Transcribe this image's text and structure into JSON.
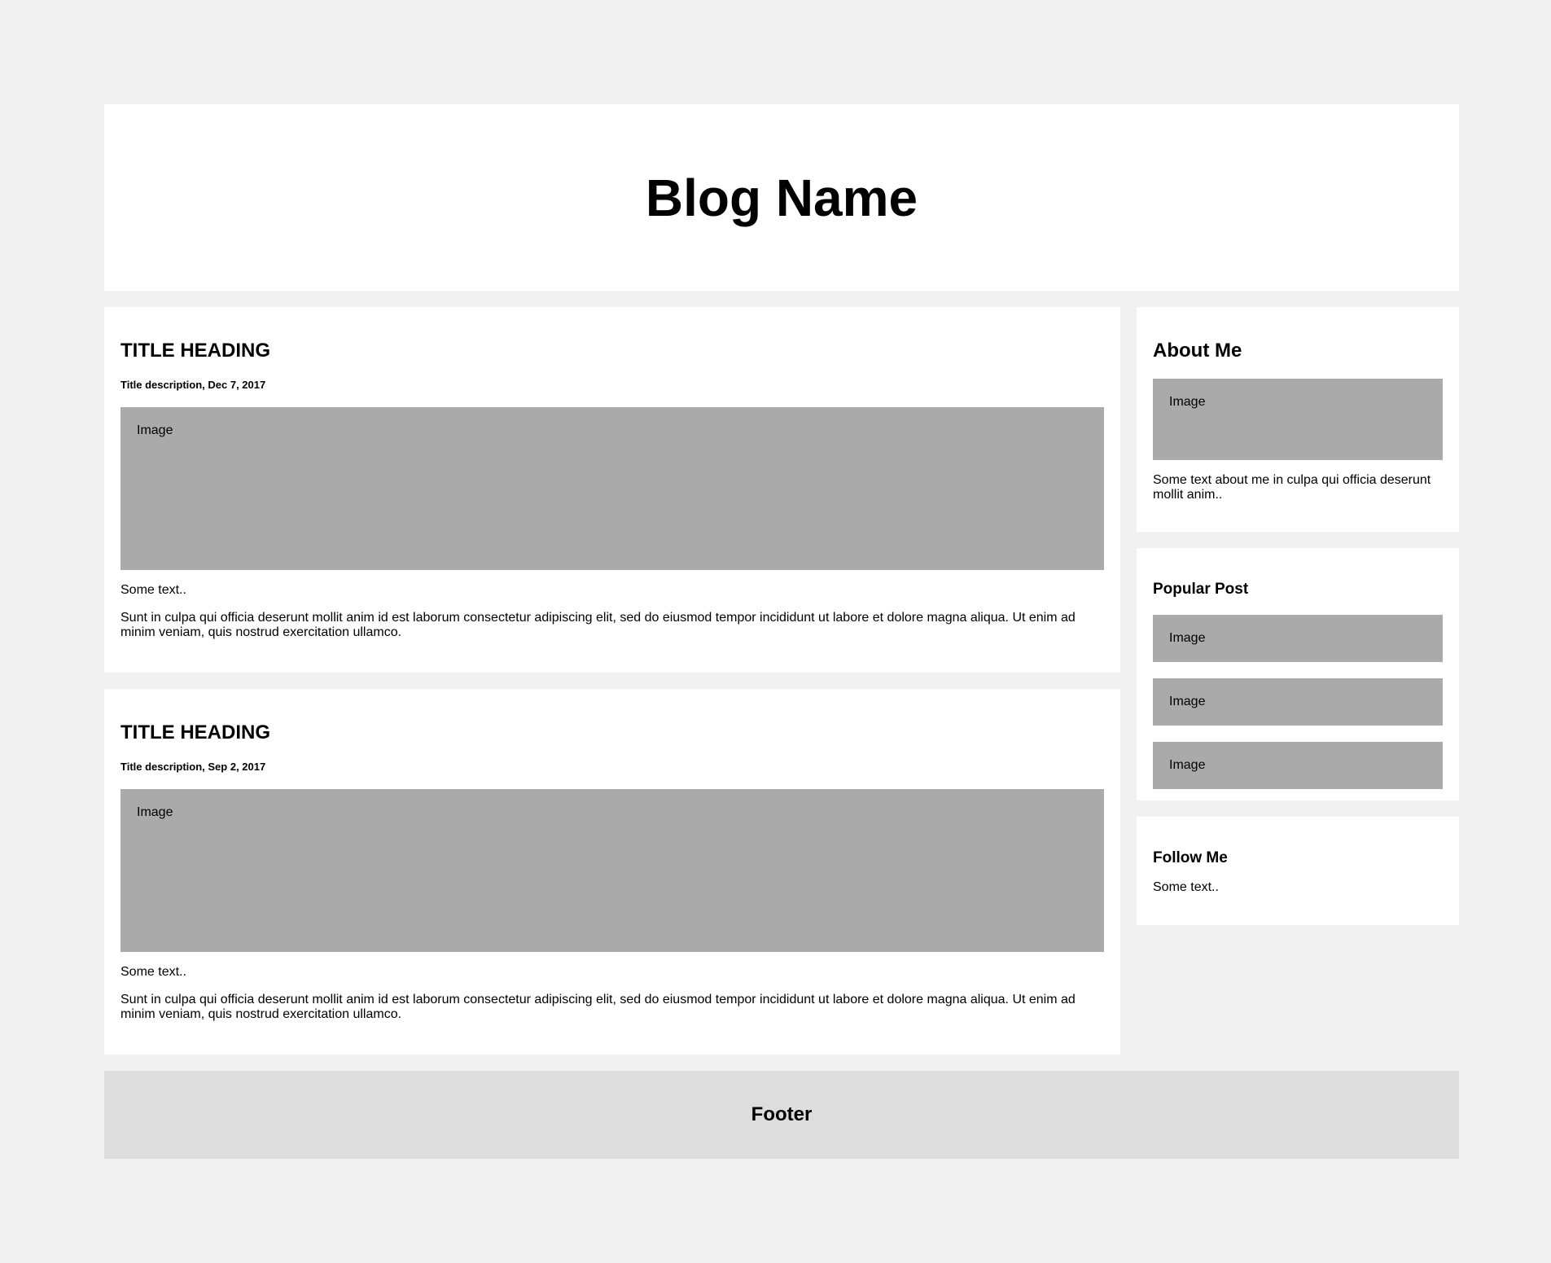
{
  "header": {
    "title": "Blog Name"
  },
  "posts": [
    {
      "title": "TITLE HEADING",
      "description": "Title description, Dec 7, 2017",
      "image_label": "Image",
      "short_text": "Some text..",
      "body": "Sunt in culpa qui officia deserunt mollit anim id est laborum consectetur adipiscing elit, sed do eiusmod tempor incididunt ut labore et dolore magna aliqua. Ut enim ad minim veniam, quis nostrud exercitation ullamco."
    },
    {
      "title": "TITLE HEADING",
      "description": "Title description, Sep 2, 2017",
      "image_label": "Image",
      "short_text": "Some text..",
      "body": "Sunt in culpa qui officia deserunt mollit anim id est laborum consectetur adipiscing elit, sed do eiusmod tempor incididunt ut labore et dolore magna aliqua. Ut enim ad minim veniam, quis nostrud exercitation ullamco."
    }
  ],
  "sidebar": {
    "about": {
      "title": "About Me",
      "image_label": "Image",
      "text": "Some text about me in culpa qui officia deserunt mollit anim.."
    },
    "popular": {
      "title": "Popular Post",
      "items": [
        {
          "label": "Image"
        },
        {
          "label": "Image"
        },
        {
          "label": "Image"
        }
      ]
    },
    "follow": {
      "title": "Follow Me",
      "text": "Some text.."
    }
  },
  "footer": {
    "title": "Footer"
  }
}
